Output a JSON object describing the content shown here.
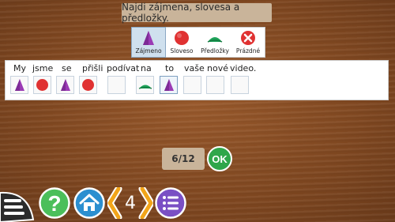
{
  "instruction": "Najdi zájmena, slovesa a předložky.",
  "legend": [
    {
      "label": "Zájmeno",
      "icon": "triangle-icon",
      "color": "#9b3bb5",
      "selected": true
    },
    {
      "label": "Sloveso",
      "icon": "circle-icon",
      "color": "#e03232",
      "selected": false
    },
    {
      "label": "Předložky",
      "icon": "dome-icon",
      "color": "#1fa35a",
      "selected": false
    },
    {
      "label": "Prázdné",
      "icon": "close-icon",
      "color": "#e03232",
      "selected": false
    }
  ],
  "sentence": {
    "words": [
      "My",
      "jsme",
      "se",
      "přišli",
      "podívat",
      "na",
      "to",
      "vaše",
      "nové",
      "video."
    ],
    "marks": [
      "triangle",
      "circle",
      "triangle",
      "circle",
      "",
      "dome",
      "triangle",
      "",
      "",
      ""
    ],
    "active_index": 6
  },
  "progress": {
    "label": "6/12"
  },
  "ok_label": "OK",
  "pager": {
    "page": "4"
  },
  "colors": {
    "ok": "#2fa64a",
    "help": "#4bbf5a",
    "home": "#2b8fd0",
    "menu": "#7a4fc4",
    "prev_next": "#f2a51a"
  }
}
